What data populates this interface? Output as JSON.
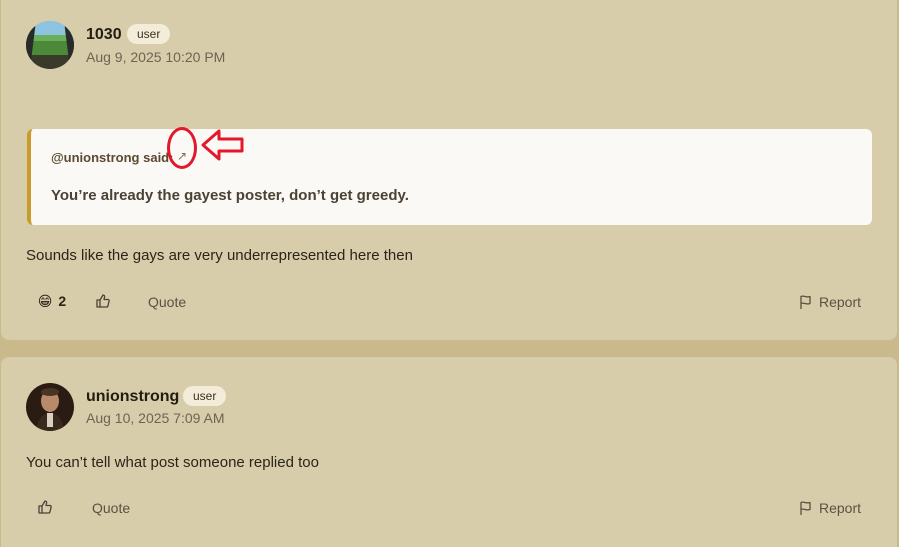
{
  "posts": [
    {
      "username": "1030",
      "role_badge": "user",
      "timestamp": "Aug 9, 2025 10:20 PM",
      "quote": {
        "author": "@unionstrong said:",
        "link_icon": "↗",
        "text": "You’re already the gayest poster, don’t get greedy."
      },
      "body": "Sounds like the gays are very underrepresented here then",
      "reaction": {
        "emoji": "😁",
        "count": "2"
      },
      "actions": {
        "quote": "Quote",
        "report": "Report"
      }
    },
    {
      "username": "unionstrong",
      "role_badge": "user",
      "timestamp": "Aug 10, 2025 7:09 AM",
      "body": "You can’t tell what post someone replied too",
      "actions": {
        "quote": "Quote",
        "report": "Report"
      }
    }
  ],
  "colors": {
    "page_bg": "#c9b98b",
    "card_bg": "#d8cdab",
    "quote_border": "#c99a2c",
    "annotation_red": "#e3182b"
  }
}
